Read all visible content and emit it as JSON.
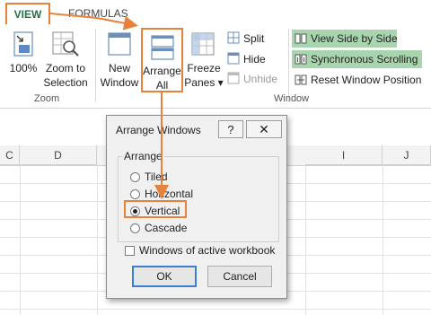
{
  "tabs": {
    "view": "VIEW",
    "formulas": "FORMULAS"
  },
  "ribbon": {
    "zoom_100": "100%",
    "zoom_to_selection": [
      "Zoom to",
      "Selection"
    ],
    "new_window": [
      "New",
      "Window"
    ],
    "arrange_all": [
      "Arrange",
      "All"
    ],
    "freeze_panes": [
      "Freeze",
      "Panes ▾"
    ],
    "split": "Split",
    "hide": "Hide",
    "unhide": "Unhide",
    "view_side_by_side": "View Side by Side",
    "synchronous_scrolling": "Synchronous Scrolling",
    "reset_window_position": "Reset Window Position",
    "group_zoom": "Zoom",
    "group_window": "Window"
  },
  "columns": [
    "C",
    "D",
    "I",
    "J"
  ],
  "dialog": {
    "title": "Arrange Windows",
    "help": "?",
    "close": "✕",
    "arrange_label": "Arrange",
    "options": [
      "Tiled",
      "Horizontal",
      "Vertical",
      "Cascade"
    ],
    "selected": "Vertical",
    "checkbox_label": "Windows of active workbook",
    "ok": "OK",
    "cancel": "Cancel"
  },
  "colors": {
    "accent": "#e8823a",
    "highlight": "#a8d5ad",
    "brand": "#217346"
  }
}
